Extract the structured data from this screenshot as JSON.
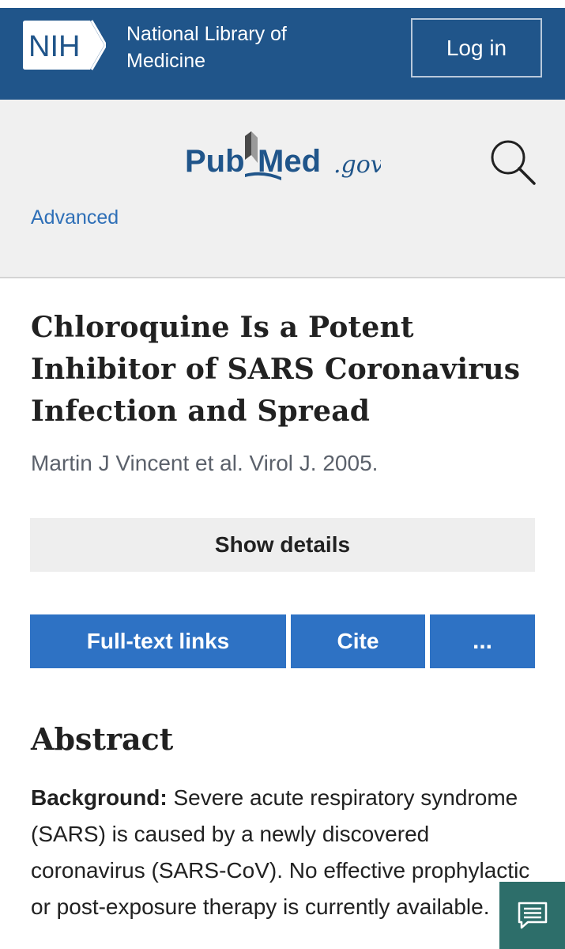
{
  "nih_header": {
    "logo_text": "NIH",
    "org_name": "National Library of Medicine",
    "login_label": "Log in"
  },
  "pubmed_header": {
    "logo_pub": "Pub",
    "logo_med": "Med",
    "logo_gov": ".gov",
    "advanced_label": "Advanced"
  },
  "article": {
    "title": "Chloroquine Is a Potent Inhibitor of SARS Coronavirus Infection and Spread",
    "citation": "Martin J Vincent et al. Virol J. 2005.",
    "show_details_label": "Show details",
    "actions": {
      "full_text_label": "Full-text links",
      "cite_label": "Cite",
      "more_label": "..."
    }
  },
  "abstract": {
    "heading": "Abstract",
    "background_label": "Background:",
    "background_text": " Severe acute respiratory syndrome (SARS) is caused by a newly discovered coronavirus (SARS-CoV). No effective prophylactic or post-exposure therapy is currently available."
  },
  "colors": {
    "nih_blue": "#20558a",
    "pubmed_blue": "#2e72c4",
    "feedback_teal": "#2d6e6a"
  },
  "icons": [
    "search-icon",
    "feedback-icon"
  ]
}
